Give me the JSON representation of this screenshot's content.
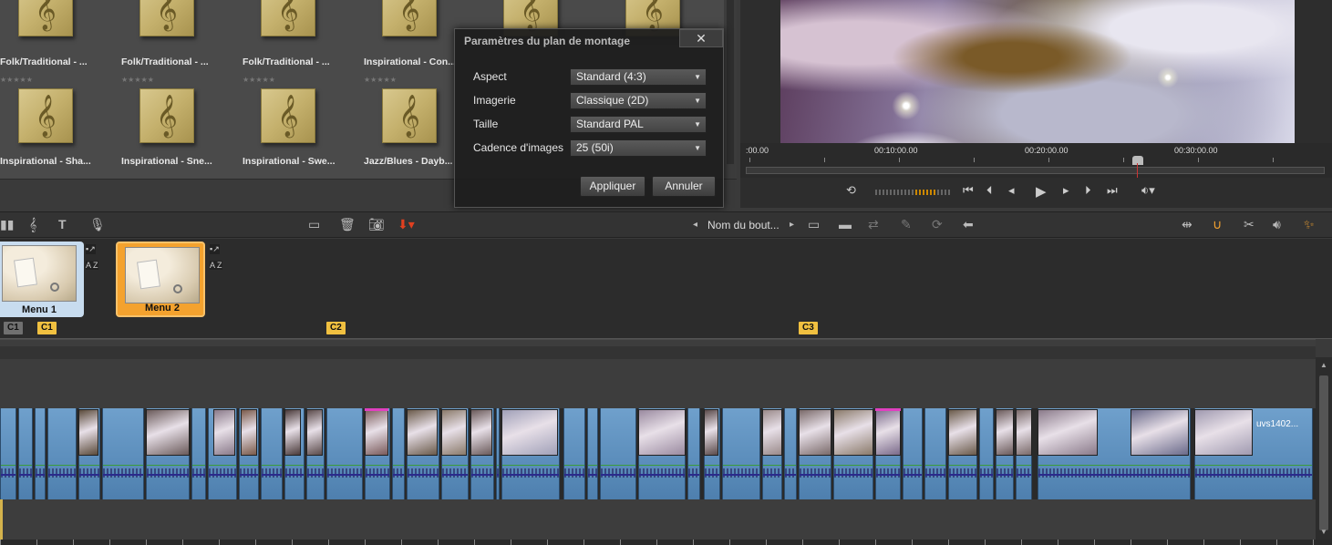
{
  "library": {
    "items": [
      {
        "label": "Folk/Traditional - ...",
        "stars": "★★★★★",
        "glyph": "𝄞"
      },
      {
        "label": "Folk/Traditional - ...",
        "stars": "★★★★★",
        "glyph": "𝄞"
      },
      {
        "label": "Folk/Traditional - ...",
        "stars": "★★★★★",
        "glyph": "𝄞"
      },
      {
        "label": "Inspirational - Con...",
        "stars": "★★★★★",
        "glyph": "𝄞"
      },
      {
        "label": "Inspirational - Sha...",
        "stars": "",
        "glyph": "𝄞"
      },
      {
        "label": "Inspirational - Sne...",
        "stars": "",
        "glyph": "𝄞"
      },
      {
        "label": "Inspirational - Swe...",
        "stars": "",
        "glyph": "𝄞"
      },
      {
        "label": "Jazz/Blues - Dayb...",
        "stars": "",
        "glyph": "𝄞"
      }
    ]
  },
  "dialog": {
    "title": "Paramètres du plan de montage",
    "close": "✕",
    "fields": [
      {
        "label": "Aspect",
        "value": "Standard (4:3)"
      },
      {
        "label": "Imagerie",
        "value": "Classique (2D)"
      },
      {
        "label": "Taille",
        "value": "Standard PAL"
      },
      {
        "label": "Cadence d'images",
        "value": "25 (50i)"
      }
    ],
    "apply": "Appliquer",
    "cancel": "Annuler"
  },
  "preview": {
    "timecodes": [
      ":00.00",
      "00:10:00.00",
      "00:20:00.00",
      "00:30:00.00"
    ]
  },
  "toolbar": {
    "button_name": "Nom du bout...",
    "prev": "◂",
    "next": "▸"
  },
  "menus": [
    {
      "label": "Menu 1",
      "selected": false
    },
    {
      "label": "Menu 2",
      "selected": true
    }
  ],
  "menu_side": {
    "az": "A Z"
  },
  "chapters": [
    {
      "label": "C1",
      "style": "grey"
    },
    {
      "label": "C1",
      "style": "yellow"
    },
    {
      "label": "C2",
      "style": "yellow"
    },
    {
      "label": "C3",
      "style": "yellow"
    }
  ],
  "timeline": {
    "clip_name": "uvs1402..."
  },
  "colors": {
    "accent": "#f0a030",
    "clip_blue": "#5b8dbb",
    "chapter_marker": "#f0c040"
  }
}
